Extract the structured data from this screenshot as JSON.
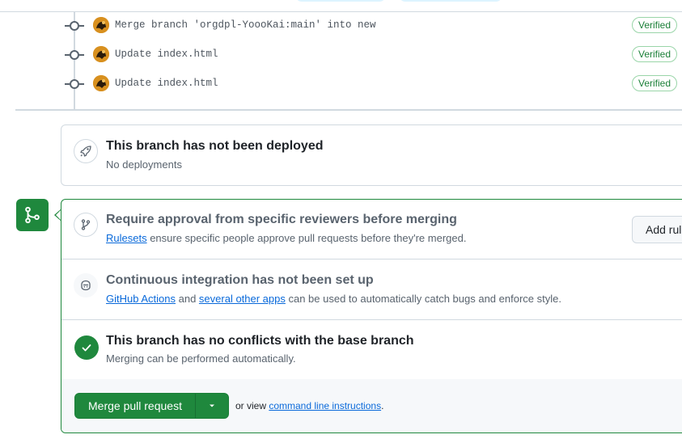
{
  "commits": [
    {
      "message": "Merge branch 'orgdpl-YoooKai:main' into new",
      "badge": "Verified"
    },
    {
      "message": "Update index.html",
      "badge": "Verified"
    },
    {
      "message": "Update index.html",
      "badge": "Verified"
    }
  ],
  "deployment": {
    "title": "This branch has not been deployed",
    "subtitle": "No deployments"
  },
  "merge_box": {
    "rules": {
      "title": "Require approval from specific reviewers before merging",
      "link": "Rulesets",
      "text": " ensure specific people approve pull requests before they're merged.",
      "button": "Add rule"
    },
    "ci": {
      "title": "Continuous integration has not been set up",
      "link1": "GitHub Actions",
      "and": " and ",
      "link2": "several other apps",
      "text": " can be used to automatically catch bugs and enforce style."
    },
    "conflicts": {
      "title": "This branch has no conflicts with the base branch",
      "subtitle": "Merging can be performed automatically."
    },
    "footer": {
      "merge_button": "Merge pull request",
      "or_view": "or view ",
      "cli_link": "command line instructions",
      "period": "."
    }
  },
  "colors": {
    "success": "#1f883d",
    "link": "#0969da",
    "muted": "#59636e",
    "border": "#d1d9e0"
  },
  "icons": {
    "commit": "git-commit-icon",
    "deploy": "rocket-icon",
    "merge": "git-merge-icon",
    "ruleset": "git-branch-icon",
    "ci": "copilot-icon",
    "check": "check-icon",
    "caret": "triangle-down-icon"
  }
}
